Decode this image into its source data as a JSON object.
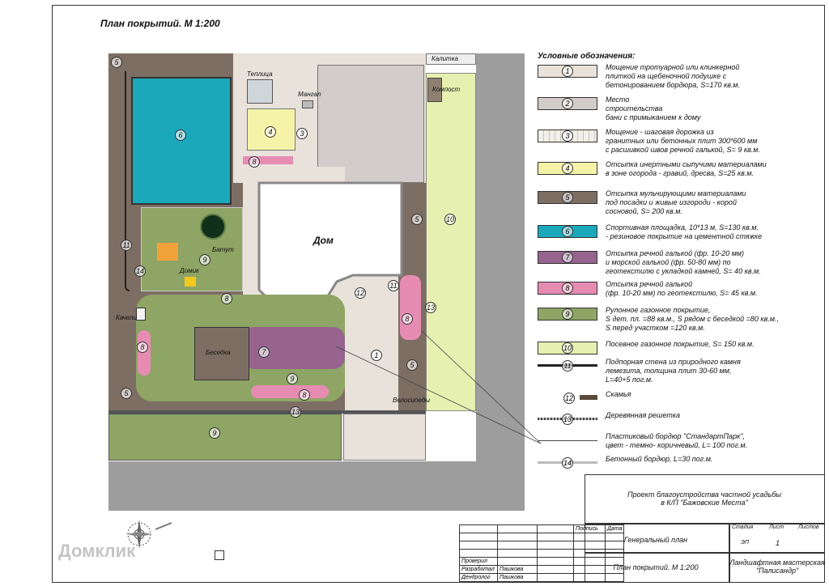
{
  "title": "План покрытий. М 1:200",
  "labels": {
    "house": "Дом",
    "greenhouse": "Теплица",
    "grill": "Мангал",
    "gate": "Калитка",
    "compost": "Компост",
    "trampoline": "Батут",
    "playhouse": "Домик",
    "swings": "Качели",
    "gazebo": "Беседка",
    "bikes": "Велосипеды"
  },
  "legend": {
    "title": "Условные обозначения:",
    "items": [
      {
        "num": "1",
        "color": "#e8e2da",
        "text": "Мощение тротуарной или клинкерной\nплиткой на щебеночной подушке с\nбетонированием бордюра, S=170 кв.м."
      },
      {
        "num": "2",
        "color": "#d2cdca",
        "text": "Место\nстроительства\nбани с примыканием к дому"
      },
      {
        "num": "3",
        "color": "#f1efe9",
        "text": "Мощение - шаговая дорожка из\nгранитных или бетонных плит 300*600 мм\nс расшивкой швов речной галькой, S= 9 кв.м."
      },
      {
        "num": "4",
        "color": "#f5f3a8",
        "text": "Отсыпка инертными сыпучими материалами\nв зоне огорода - гравий, дресва, S=25 кв.м."
      },
      {
        "num": "5",
        "color": "#7d6e63",
        "text": "Отсыпка мульчирующими материалами\nпод посадки и живые изгороди - корой\nсосновой, S= 200 кв.м."
      },
      {
        "num": "6",
        "color": "#1aa8ba",
        "text": "Спортивная площадка, 10*13 м, S=130 кв.м.\n- резиновое покрытие на цементной стяжке"
      },
      {
        "num": "7",
        "color": "#96648f",
        "text": "Отсыпка речной галькой (фр. 10-20 мм)\nи морской галькой (фр. 50-80 мм) по\nгеотекстилю с укладкой камней, S= 40 кв.м."
      },
      {
        "num": "8",
        "color": "#e68cb3",
        "text": "Отсыпка речной галькой\n(фр. 10-20 мм) по геотекстилю, S= 45 кв.м."
      },
      {
        "num": "9",
        "color": "#8ea565",
        "text": "Рулонное газонное покрытие,\nS дет. пл. =88 кв.м., S рядом с беседкой =80 кв.м.,\nS перед участком =120 кв.м."
      },
      {
        "num": "10",
        "color": "#e6f0b0",
        "text": "Посевное газонное покрытие, S= 150 кв.м."
      },
      {
        "num": "11",
        "color": "",
        "text": "Подпорная стена из природного камня\nлемезита, толщина плит 30-60 мм,\nL=40+5 пог.м."
      },
      {
        "num": "12",
        "color": "",
        "text": "Скамья"
      },
      {
        "num": "13",
        "color": "",
        "text": "Деревянная решетка"
      },
      {
        "num": "",
        "color": "",
        "text": "Пластиковый бордюр \"СтандартПарк\",\nцвет - темно- коричневый, L= 100 пог.м."
      },
      {
        "num": "14",
        "color": "",
        "text": "Бетонный бордюр, L=30 пог.м."
      }
    ]
  },
  "stamp": {
    "project": "Проект благоустройства частной усадьбы\nв К/П \"Бажовские Места\"",
    "sheet_name": "Генеральный план",
    "drawing": "План покрытий. М 1:200",
    "studio": "Ландшафтная мастерская\n\"Палисандр\"",
    "col_stage": "Стадия",
    "col_sheet": "Лист",
    "col_sheets": "Листов",
    "stage": "ЭП",
    "sheet": "1",
    "sign_h": "Подпись",
    "date_h": "Дата",
    "roles": [
      "Проверил",
      "Разработал",
      "Дендролог"
    ],
    "names": [
      "",
      "Пашкова",
      "Пашкова"
    ]
  },
  "watermark": "Домклик"
}
